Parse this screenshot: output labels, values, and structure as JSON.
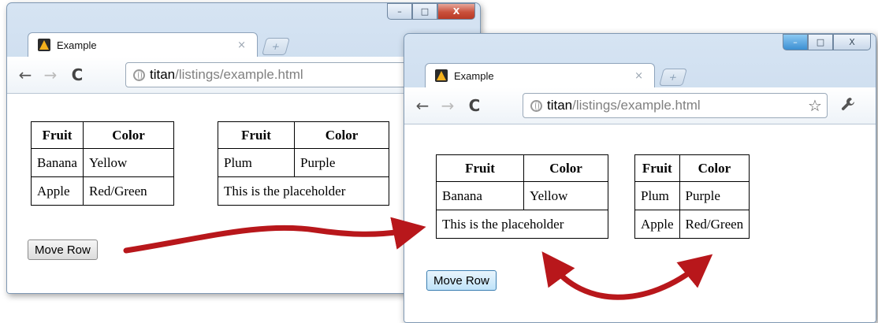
{
  "window_before": {
    "tab": {
      "title": "Example",
      "close_glyph": "×"
    },
    "address": {
      "host": "titan",
      "path": "/listings/example.html"
    },
    "nav": {
      "back": "←",
      "forward": "→",
      "reload": "C"
    },
    "caption_buttons": {
      "minimize": "–",
      "maximize": "□",
      "close": "X"
    },
    "table1": {
      "headers": [
        "Fruit",
        "Color"
      ],
      "rows": [
        [
          "Banana",
          "Yellow"
        ],
        [
          "Apple",
          "Red/Green"
        ]
      ]
    },
    "table2": {
      "headers": [
        "Fruit",
        "Color"
      ],
      "rows": [
        [
          "Plum",
          "Purple"
        ]
      ],
      "placeholder": "This is the placeholder"
    },
    "button_label": "Move Row"
  },
  "window_after": {
    "tab": {
      "title": "Example",
      "close_glyph": "×"
    },
    "address": {
      "host": "titan",
      "path": "/listings/example.html"
    },
    "nav": {
      "back": "←",
      "forward": "→",
      "reload": "C"
    },
    "caption_buttons": {
      "minimize": "–",
      "maximize": "□",
      "close": "X"
    },
    "table1": {
      "headers": [
        "Fruit",
        "Color"
      ],
      "rows": [
        [
          "Banana",
          "Yellow"
        ]
      ],
      "placeholder": "This is the placeholder"
    },
    "table2": {
      "headers": [
        "Fruit",
        "Color"
      ],
      "rows": [
        [
          "Plum",
          "Purple"
        ],
        [
          "Apple",
          "Red/Green"
        ]
      ]
    },
    "button_label": "Move Row"
  },
  "icons": {
    "star": "☆",
    "wrench": "🔧",
    "new_tab": "+"
  },
  "colors": {
    "arrow": "#b8171b",
    "window_frame": "#c3d5ea",
    "button_hover": "#bfe3f9"
  }
}
